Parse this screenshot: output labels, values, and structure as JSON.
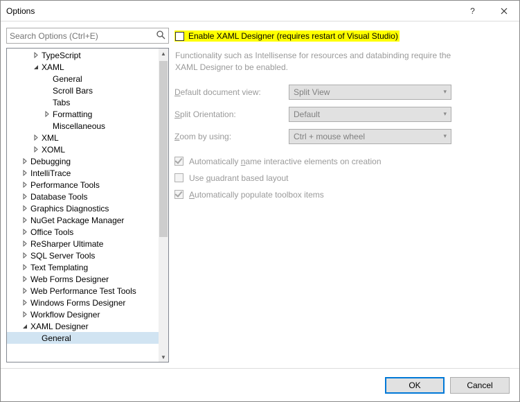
{
  "window": {
    "title": "Options"
  },
  "search": {
    "placeholder": "Search Options (Ctrl+E)"
  },
  "tree": [
    {
      "indent": 2,
      "expander": "closed",
      "label": "TypeScript"
    },
    {
      "indent": 2,
      "expander": "open",
      "label": "XAML"
    },
    {
      "indent": 3,
      "expander": "none",
      "label": "General"
    },
    {
      "indent": 3,
      "expander": "none",
      "label": "Scroll Bars"
    },
    {
      "indent": 3,
      "expander": "none",
      "label": "Tabs"
    },
    {
      "indent": 3,
      "expander": "closed",
      "label": "Formatting"
    },
    {
      "indent": 3,
      "expander": "none",
      "label": "Miscellaneous"
    },
    {
      "indent": 2,
      "expander": "closed",
      "label": "XML"
    },
    {
      "indent": 2,
      "expander": "closed",
      "label": "XOML"
    },
    {
      "indent": 1,
      "expander": "closed",
      "label": "Debugging"
    },
    {
      "indent": 1,
      "expander": "closed",
      "label": "IntelliTrace"
    },
    {
      "indent": 1,
      "expander": "closed",
      "label": "Performance Tools"
    },
    {
      "indent": 1,
      "expander": "closed",
      "label": "Database Tools"
    },
    {
      "indent": 1,
      "expander": "closed",
      "label": "Graphics Diagnostics"
    },
    {
      "indent": 1,
      "expander": "closed",
      "label": "NuGet Package Manager"
    },
    {
      "indent": 1,
      "expander": "closed",
      "label": "Office Tools"
    },
    {
      "indent": 1,
      "expander": "closed",
      "label": "ReSharper Ultimate"
    },
    {
      "indent": 1,
      "expander": "closed",
      "label": "SQL Server Tools"
    },
    {
      "indent": 1,
      "expander": "closed",
      "label": "Text Templating"
    },
    {
      "indent": 1,
      "expander": "closed",
      "label": "Web Forms Designer"
    },
    {
      "indent": 1,
      "expander": "closed",
      "label": "Web Performance Test Tools"
    },
    {
      "indent": 1,
      "expander": "closed",
      "label": "Windows Forms Designer"
    },
    {
      "indent": 1,
      "expander": "closed",
      "label": "Workflow Designer"
    },
    {
      "indent": 1,
      "expander": "open",
      "label": "XAML Designer"
    },
    {
      "indent": 2,
      "expander": "none",
      "label": "General",
      "selected": true
    }
  ],
  "main": {
    "enable_label": "Enable XAML Designer (requires restart of Visual Studio)",
    "description": "Functionality such as Intellisense for resources and databinding require the XAML Designer to be enabled.",
    "default_view_label_pre": "D",
    "default_view_label_rest": "efault document view:",
    "default_view_value": "Split View",
    "split_orientation_label_pre": "S",
    "split_orientation_label_rest": "plit Orientation:",
    "split_orientation_value": "Default",
    "zoom_label_pre": "Z",
    "zoom_label_rest": "oom by using:",
    "zoom_value": "Ctrl + mouse wheel",
    "auto_name_pre": "Automatically ",
    "auto_name_u": "n",
    "auto_name_post": "ame interactive elements on creation",
    "quadrant_pre": "Use ",
    "quadrant_u": "q",
    "quadrant_post": "uadrant based layout",
    "auto_toolbox_u": "A",
    "auto_toolbox_post": "utomatically populate toolbox items"
  },
  "footer": {
    "ok": "OK",
    "cancel": "Cancel"
  }
}
